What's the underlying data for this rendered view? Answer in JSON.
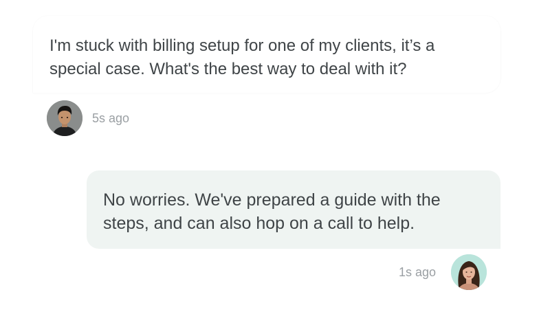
{
  "messages": [
    {
      "direction": "incoming",
      "text": "I'm stuck with billing setup for one of my clients, it’s a special case. What's the best way to deal with it?",
      "timestamp": "5s ago",
      "avatar": "user-avatar"
    },
    {
      "direction": "outgoing",
      "text": "No worries. We've prepared a guide with the steps, and can also hop on a call to help.",
      "timestamp": "1s ago",
      "avatar": "agent-avatar"
    }
  ],
  "colors": {
    "incoming_bubble": "#ffffff",
    "outgoing_bubble": "#eff4f2",
    "message_text": "#3f4447",
    "timestamp_text": "#9a9fa3",
    "agent_avatar_bg": "#b9e4db"
  }
}
